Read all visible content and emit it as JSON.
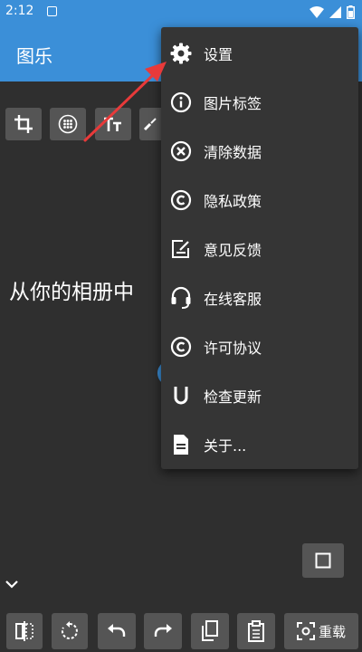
{
  "status_bar": {
    "time": "2:12"
  },
  "app_bar": {
    "title": "图乐"
  },
  "main": {
    "welcome_text": "从你的相册中",
    "reload_label": "重载"
  },
  "menu": {
    "items": [
      {
        "label": "设置",
        "icon": "gear-icon"
      },
      {
        "label": "图片标签",
        "icon": "info-icon"
      },
      {
        "label": "清除数据",
        "icon": "clear-circle-icon"
      },
      {
        "label": "隐私政策",
        "icon": "copyright-icon"
      },
      {
        "label": "意见反馈",
        "icon": "feedback-icon"
      },
      {
        "label": "在线客服",
        "icon": "headset-icon"
      },
      {
        "label": "许可协议",
        "icon": "copyright-icon"
      },
      {
        "label": "检查更新",
        "icon": "update-u-icon"
      },
      {
        "label": "关于...",
        "icon": "document-icon"
      }
    ]
  },
  "colors": {
    "app_bar": "#3b8fd8",
    "background": "#2f2f2f",
    "menu_background": "#353535",
    "button": "#555555",
    "annotation_arrow": "#e83a3a"
  }
}
